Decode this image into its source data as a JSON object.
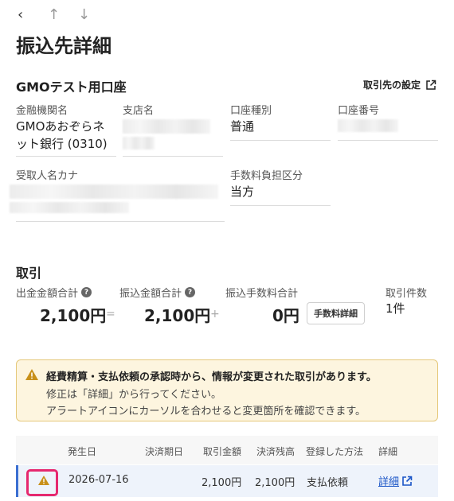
{
  "nav": {
    "back": "‹",
    "up": "↑",
    "down": "↓"
  },
  "page": {
    "title": "振込先詳細"
  },
  "account": {
    "name": "GMOテスト用口座",
    "settings_link": "取引先の設定",
    "fields": {
      "bank_label": "金融機関名",
      "bank_value_line1": "GMOあおぞらネ",
      "bank_value_line2": "ット銀行 (0310)",
      "branch_label": "支店名",
      "type_label": "口座種別",
      "type_value": "普通",
      "number_label": "口座番号",
      "payee_label": "受取人名カナ",
      "fee_label": "手数料負担区分",
      "fee_value": "当方"
    }
  },
  "transactions": {
    "section_title": "取引",
    "summary": {
      "out_label": "出金金額合計",
      "out_value": "2,100円",
      "eq": "=",
      "transfer_label": "振込金額合計",
      "transfer_value": "2,100円",
      "plus": "+",
      "fee_label": "振込手数料合計",
      "fee_value": "0円",
      "fee_button": "手数料詳細",
      "count_label": "取引件数",
      "count_value": "1件"
    },
    "alert": {
      "line1": "経費精算・支払依頼の承認時から、情報が変更された取引があります。",
      "line2": "修正は「詳細」から行ってください。",
      "line3": "アラートアイコンにカーソルを合わせると変更箇所を確認できます。"
    },
    "table": {
      "headers": [
        "発生日",
        "決済期日",
        "取引金額",
        "決済残高",
        "登録した方法",
        "詳細"
      ],
      "rows": [
        {
          "date": "2026-07-16",
          "due": "",
          "amount": "2,100円",
          "balance": "2,100円",
          "method": "支払依頼",
          "detail": "詳細"
        }
      ]
    }
  },
  "colors": {
    "accent": "#1a55c7",
    "warning": "#c8901a",
    "highlight": "#e6286f"
  }
}
